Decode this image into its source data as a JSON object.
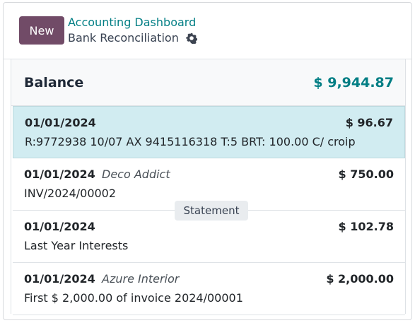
{
  "header": {
    "new_label": "New",
    "breadcrumb_parent": "Accounting Dashboard",
    "breadcrumb_current": "Bank Reconciliation"
  },
  "balance": {
    "label": "Balance",
    "amount": "$ 9,944.87"
  },
  "transactions": [
    {
      "date": "01/01/2024",
      "partner": "",
      "amount": "$ 96.67",
      "reference": "R:9772938 10/07 AX 9415116318 T:5 BRT: 100.00 C/ croip",
      "selected": true
    },
    {
      "date": "01/01/2024",
      "partner": "Deco Addict",
      "amount": "$ 750.00",
      "reference": "INV/2024/00002",
      "selected": false
    },
    {
      "date": "01/01/2024",
      "partner": "",
      "amount": "$ 102.78",
      "reference": "Last Year Interests",
      "selected": false
    },
    {
      "date": "01/01/2024",
      "partner": "Azure Interior",
      "amount": "$ 2,000.00",
      "reference": "First $ 2,000.00 of invoice 2024/00001",
      "selected": false
    }
  ],
  "statement_badge": "Statement",
  "colors": {
    "primary": "#714b67",
    "accent": "#017e84",
    "selected_row": "#d1ecf1"
  }
}
